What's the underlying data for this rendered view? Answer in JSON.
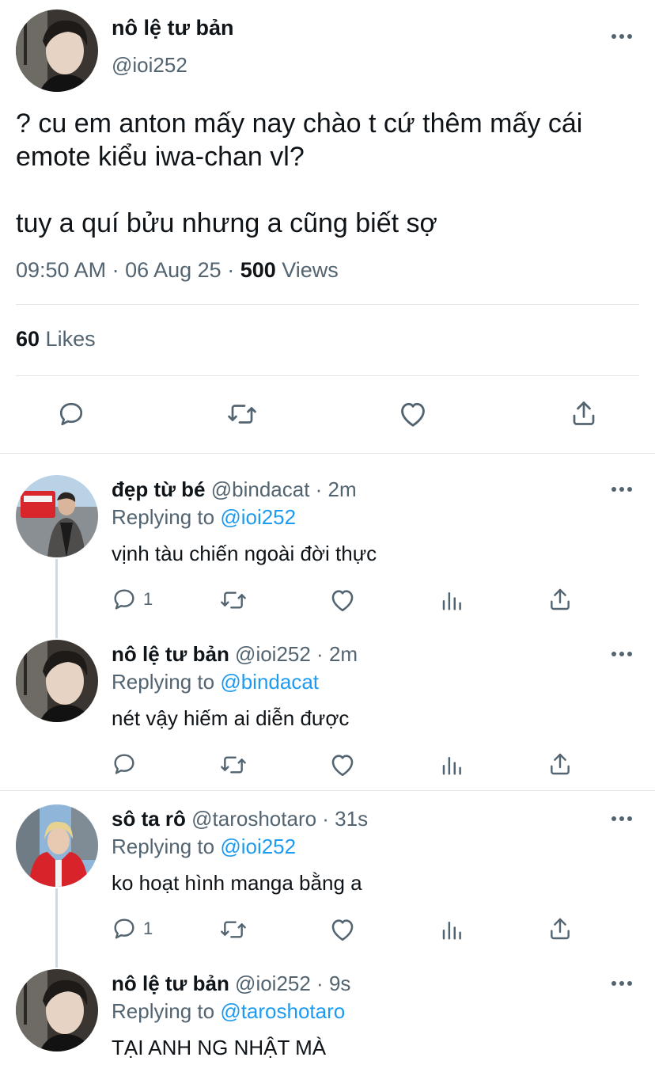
{
  "main": {
    "name": "nô lệ tư bản",
    "handle": "@ioi252",
    "text": "? cu em anton mấy nay chào t cứ thêm mấy cái\nemote kiểu iwa-chan vl?\n\ntuy a quí bửu nhưng a cũng biết sợ",
    "time": "09:50 AM · 06 Aug 25 · ",
    "views_count": "500",
    "views_label": " Views",
    "likes_count": "60",
    "likes_label": " Likes"
  },
  "replies": [
    {
      "name": "đẹp từ bé",
      "handle_time": " @bindacat · 2m",
      "replying_prefix": "Replying to ",
      "replying_to": "@ioi252",
      "text": "vịnh tàu chiến ngoài đời thực",
      "reply_count": "1"
    },
    {
      "name": "nô lệ tư bản",
      "handle_time": " @ioi252 · 2m",
      "replying_prefix": "Replying to ",
      "replying_to": "@bindacat",
      "text": "nét vậy hiếm ai diễn được",
      "reply_count": ""
    },
    {
      "name": "sô ta rô",
      "handle_time": " @taroshotaro · 31s",
      "replying_prefix": "Replying to ",
      "replying_to": "@ioi252",
      "text": "ko hoạt hình manga bằng a",
      "reply_count": "1"
    },
    {
      "name": "nô lệ tư bản",
      "handle_time": " @ioi252 · 9s",
      "replying_prefix": "Replying to ",
      "replying_to": "@taroshotaro",
      "text": "TẠI ANH NG NHẬT MÀ",
      "reply_count": ""
    }
  ],
  "colors": {
    "text": "#0f1419",
    "secondary": "#536471",
    "accent": "#1d9bf0",
    "divider": "#e1e6ea"
  }
}
